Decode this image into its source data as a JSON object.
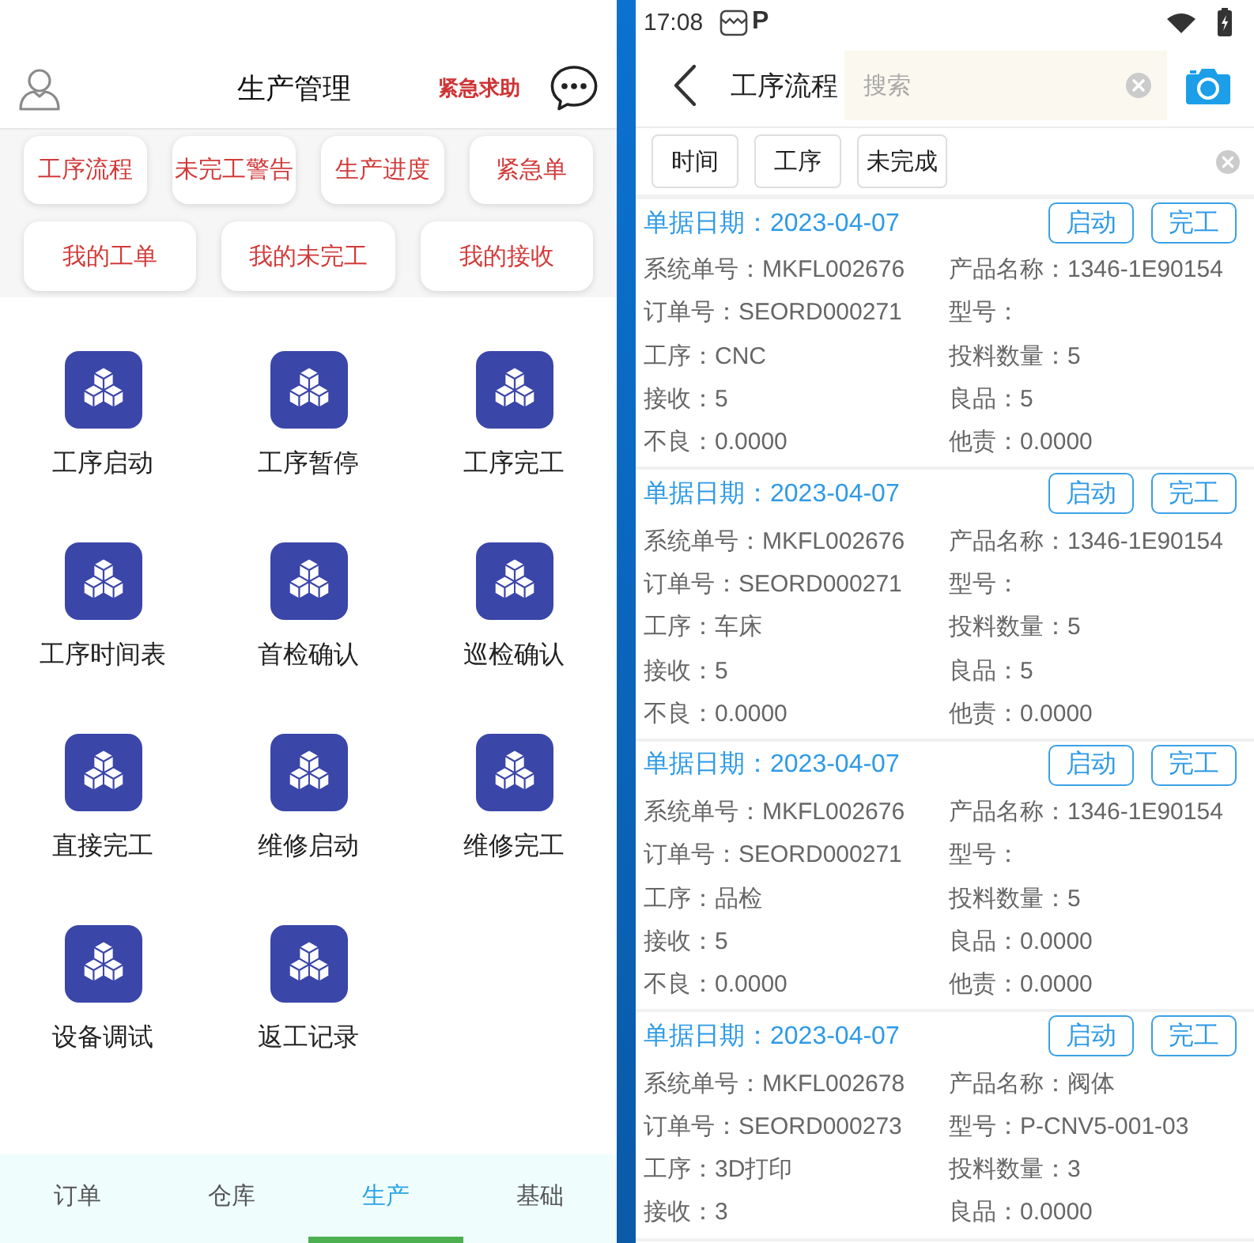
{
  "left_screen": {
    "header": {
      "title": "生产管理",
      "help_link": "紧急求助"
    },
    "quick_actions": [
      [
        "工序流程",
        "未完工警告",
        "生产进度",
        "紧急单"
      ],
      [
        "我的工单",
        "我的未完工",
        "我的接收"
      ]
    ],
    "functions": [
      {
        "label": "工序启动"
      },
      {
        "label": "工序暂停"
      },
      {
        "label": "工序完工"
      },
      {
        "label": "工序时间表"
      },
      {
        "label": "首检确认"
      },
      {
        "label": "巡检确认"
      },
      {
        "label": "直接完工"
      },
      {
        "label": "维修启动"
      },
      {
        "label": "维修完工"
      },
      {
        "label": "设备调试"
      },
      {
        "label": "返工记录"
      }
    ],
    "bottom_nav": [
      {
        "label": "订单",
        "selected": false
      },
      {
        "label": "仓库",
        "selected": false
      },
      {
        "label": "生产",
        "selected": true
      },
      {
        "label": "基础",
        "selected": false
      }
    ]
  },
  "right_screen": {
    "status_bar": {
      "time": "17:08",
      "notification_letter": "P"
    },
    "header": {
      "title": "工序流程",
      "search": {
        "placeholder": "搜索"
      }
    },
    "filters": [
      {
        "label": "时间"
      },
      {
        "label": "工序"
      },
      {
        "label": "未完成"
      }
    ],
    "records": [
      {
        "date": "单据日期：2023-04-07",
        "actions": [
          "启动",
          "完工"
        ],
        "fields": [
          "系统单号：MKFL002676",
          "产品名称：1346-1E90154",
          "订单号：SEORD000271",
          "型号：",
          "工序：CNC",
          "投料数量：5",
          "接收：5",
          "良品：5",
          "不良：0.0000",
          "他责：0.0000"
        ]
      },
      {
        "date": "单据日期：2023-04-07",
        "actions": [
          "启动",
          "完工"
        ],
        "fields": [
          "系统单号：MKFL002676",
          "产品名称：1346-1E90154",
          "订单号：SEORD000271",
          "型号：",
          "工序：车床",
          "投料数量：5",
          "接收：5",
          "良品：5",
          "不良：0.0000",
          "他责：0.0000"
        ]
      },
      {
        "date": "单据日期：2023-04-07",
        "actions": [
          "启动",
          "完工"
        ],
        "fields": [
          "系统单号：MKFL002676",
          "产品名称：1346-1E90154",
          "订单号：SEORD000271",
          "型号：",
          "工序：品检",
          "投料数量：5",
          "接收：5",
          "良品：0.0000",
          "不良：0.0000",
          "他责：0.0000"
        ]
      },
      {
        "date": "单据日期：2023-04-07",
        "actions": [
          "启动",
          "完工"
        ],
        "fields": [
          "系统单号：MKFL002678",
          "产品名称：阀体",
          "订单号：SEORD000273",
          "型号：P-CNV5-001-03",
          "工序：3D打印",
          "投料数量：3",
          "接收：3",
          "良品：0.0000"
        ]
      }
    ]
  }
}
